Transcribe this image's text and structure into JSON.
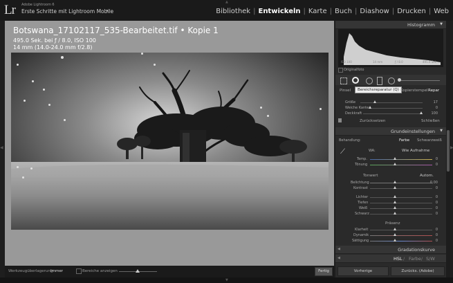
{
  "app": {
    "logo_text": "Lr",
    "name": "Adobe Lightroom 6",
    "catalog": "Erste Schritte mit Lightroom Mobile",
    "catalog_arrow": "▸"
  },
  "modules": [
    {
      "label": "Bibliothek",
      "active": false
    },
    {
      "label": "Entwickeln",
      "active": true
    },
    {
      "label": "Karte",
      "active": false
    },
    {
      "label": "Buch",
      "active": false
    },
    {
      "label": "Diashow",
      "active": false
    },
    {
      "label": "Drucken",
      "active": false
    },
    {
      "label": "Web",
      "active": false
    }
  ],
  "photo": {
    "title": "Botswana_17102117_535-Bearbeitet.tif  •  Kopie 1",
    "info_line1": "495.0 Sek. bei ƒ / 8.0, ISO 100",
    "info_line2": "14 mm (14.0-24.0 mm f/2.8)"
  },
  "histogram": {
    "title": "Histogramm",
    "iso": "ISO 100",
    "focal": "14 mm",
    "aperture": "ƒ / 8.0",
    "shutter": "495.0 Sek",
    "original_photo_label": "Originalfoto"
  },
  "tools": {
    "tooltip": "Bereichsreparatur (Q)",
    "mode_pinsel": "Pinsel",
    "mode_kopierstempel": "Kopierstempel",
    "mode_repar": "Repar",
    "groesse_label": "Größe",
    "groesse_value": "17",
    "weiche_kante_label": "Weiche Kante",
    "weiche_kante_value": "0",
    "deckkraft_label": "Deckkraft",
    "deckkraft_value": "100",
    "reset_button": "Zurücksetzen",
    "close_button": "Schließen"
  },
  "basic": {
    "title": "Grundeinstellungen",
    "behandlung_label": "Behandlung:",
    "farbe": "Farbe",
    "schwarzweiss": "Schwarzweiß",
    "wb_label": "WA:",
    "wb_value": "Wie Aufnahme",
    "temp_label": "Temp.",
    "temp_value": "0",
    "tonung_label": "Tönung",
    "tonung_value": "0",
    "tonwert_label": "Tonwert",
    "autom_button": "Autom.",
    "belichtung_label": "Belichtung",
    "belichtung_value": "0,00",
    "kontrast_label": "Kontrast",
    "kontrast_value": "0",
    "lichter_label": "Lichter",
    "lichter_value": "0",
    "tiefen_label": "Tiefen",
    "tiefen_value": "0",
    "weiss_label": "Weiß",
    "weiss_value": "0",
    "schwarz_label": "Schwarz",
    "schwarz_value": "0",
    "praesenz_label": "Präsenz",
    "klarheit_label": "Klarheit",
    "klarheit_value": "0",
    "dynamik_label": "Dynamik",
    "dynamik_value": "0",
    "saettigung_label": "Sättigung",
    "saettigung_value": "0"
  },
  "panels": {
    "gradation": "Gradationskurve",
    "hsl": "HSL",
    "hsl_farbe": "Farbe",
    "hsl_sw": "S/W",
    "divider": "/"
  },
  "buttons": {
    "vorherige": "Vorherige",
    "zuruecks": "Zurücks. (Adobe)"
  },
  "toolbar": {
    "overlay_label": "Werkzeugüberlagerung:",
    "overlay_value": "Immer",
    "bereiche_label": "Bereiche anzeigen",
    "fertig": "Fertig"
  },
  "colors": {
    "active_module": "#ffffff",
    "panel_bg": "#2a2a2a",
    "canvas_bg": "#999999"
  },
  "icons": [
    "spot-removal-icon",
    "crop-icon",
    "red-eye-icon",
    "gradient-filter-icon",
    "radial-filter-icon",
    "brush-icon",
    "eyedropper-icon",
    "switch-icon"
  ]
}
